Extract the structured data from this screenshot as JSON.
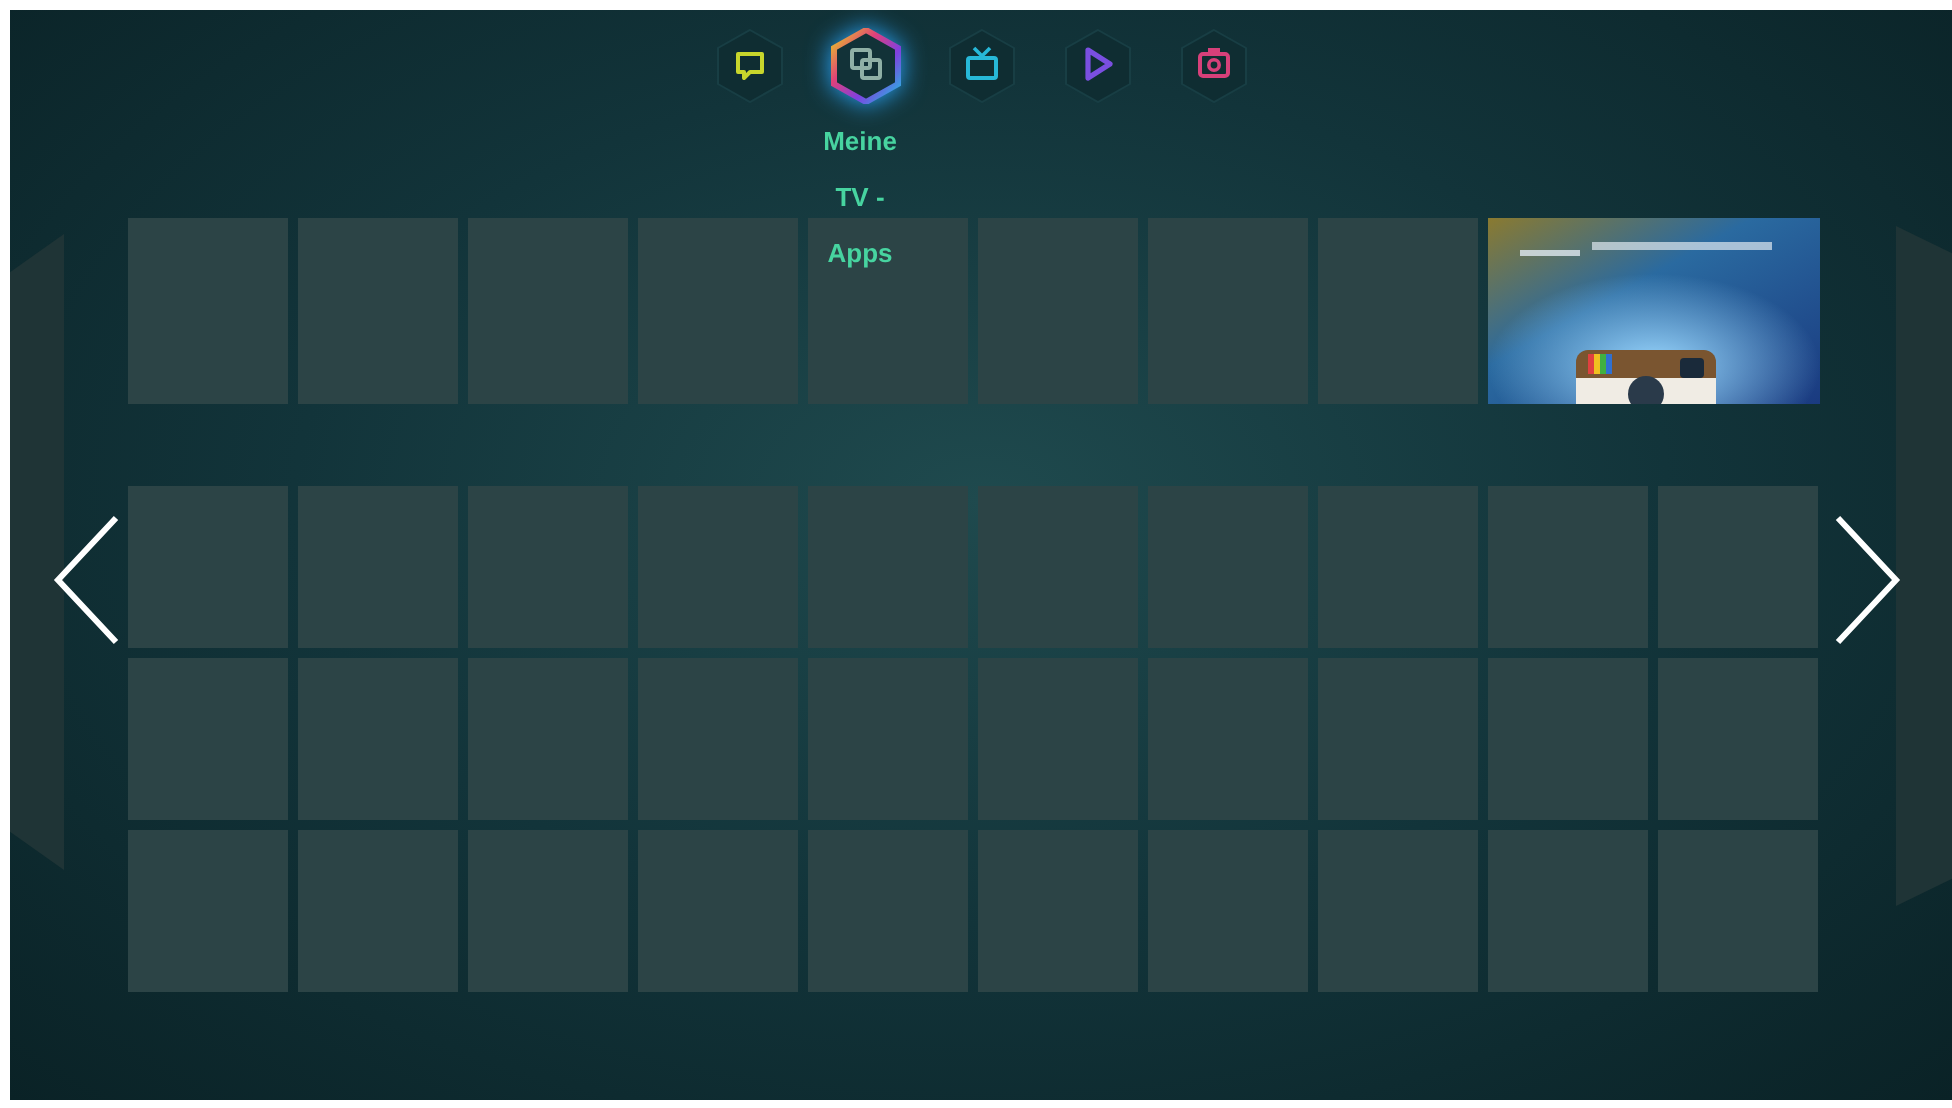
{
  "tabs": [
    {
      "kind": "chat",
      "color": "#c8d62c",
      "selected": false
    },
    {
      "kind": "apps",
      "color": "#8fb0a6",
      "selected": true
    },
    {
      "kind": "tv",
      "color": "#27b8d8",
      "selected": false
    },
    {
      "kind": "play",
      "color": "#7a4fe0",
      "selected": false
    },
    {
      "kind": "camera",
      "color": "#d6407a",
      "selected": false
    }
  ],
  "tab_label": "Meine TV - Apps",
  "featured_row": [
    {
      "kind": "empty"
    },
    {
      "kind": "empty"
    },
    {
      "kind": "empty"
    },
    {
      "kind": "empty"
    },
    {
      "kind": "empty"
    },
    {
      "kind": "empty"
    },
    {
      "kind": "empty"
    },
    {
      "kind": "empty"
    },
    {
      "kind": "picture"
    }
  ],
  "app_grid": [
    [
      {
        "kind": "empty"
      },
      {
        "kind": "empty"
      },
      {
        "kind": "empty"
      },
      {
        "kind": "empty"
      },
      {
        "kind": "empty"
      },
      {
        "kind": "empty"
      },
      {
        "kind": "empty"
      },
      {
        "kind": "empty"
      },
      {
        "kind": "empty"
      },
      {
        "kind": "empty"
      }
    ],
    [
      {
        "kind": "empty"
      },
      {
        "kind": "empty"
      },
      {
        "kind": "empty"
      },
      {
        "kind": "empty"
      },
      {
        "kind": "empty"
      },
      {
        "kind": "empty"
      },
      {
        "kind": "empty"
      },
      {
        "kind": "empty"
      },
      {
        "kind": "empty"
      },
      {
        "kind": "empty"
      }
    ],
    [
      {
        "kind": "empty"
      },
      {
        "kind": "empty"
      },
      {
        "kind": "empty"
      },
      {
        "kind": "empty"
      },
      {
        "kind": "empty"
      },
      {
        "kind": "empty"
      },
      {
        "kind": "empty"
      },
      {
        "kind": "empty"
      },
      {
        "kind": "empty"
      },
      {
        "kind": "empty"
      }
    ]
  ]
}
